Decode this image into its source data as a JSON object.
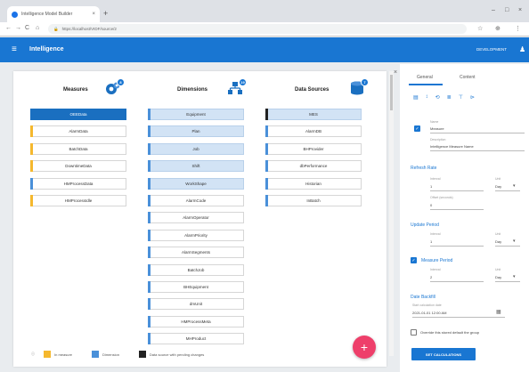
{
  "browser": {
    "tab_title": "Intelligence Model Builder",
    "tab_close": "×",
    "new_tab": "+",
    "win_min": "–",
    "win_max": "□",
    "win_close": "×",
    "nav_back": "←",
    "nav_forward": "→",
    "nav_reload": "C",
    "nav_home": "⌂",
    "url": "https://localhost/VIDF/source/2",
    "secure_icon": "🔒",
    "star_icon": "☆",
    "ext_icon": "⊕",
    "menu_icon": "⋮"
  },
  "appbar": {
    "menu_icon": "≡",
    "title": "Intelligence",
    "user": "DEVELOPMENT",
    "user_icon": "♟"
  },
  "columns": [
    {
      "title": "Measures",
      "badge": "8",
      "icon": "measures-gear-icon",
      "items": [
        {
          "label": "OEEData",
          "state": "sel-dark",
          "bar": "#1a6fc0"
        },
        {
          "label": "AlarmData",
          "state": "",
          "bar": "#f5b82e"
        },
        {
          "label": "BatchData",
          "state": "",
          "bar": "#f5b82e"
        },
        {
          "label": "DowntimeData",
          "state": "",
          "bar": "#f5b82e"
        },
        {
          "label": "HMProcessData",
          "state": "",
          "bar": "#4a90d9"
        },
        {
          "label": "HMProcessIdle",
          "state": "",
          "bar": "#f5b82e"
        }
      ]
    },
    {
      "title": "Dimensions",
      "badge": "19",
      "icon": "dimensions-hierarchy-icon",
      "items": [
        {
          "label": "Equipment",
          "state": "sel-light",
          "bar": "#4a90d9"
        },
        {
          "label": "Plan",
          "state": "sel-light",
          "bar": "#4a90d9"
        },
        {
          "label": "Job",
          "state": "sel-light",
          "bar": "#4a90d9"
        },
        {
          "label": "Shift",
          "state": "sel-light",
          "bar": "#4a90d9"
        },
        {
          "label": "WorkShape",
          "state": "sel-light",
          "bar": "#4a90d9"
        },
        {
          "label": "AlarmCode",
          "state": "",
          "bar": "#4a90d9"
        },
        {
          "label": "AlarmOperator",
          "state": "",
          "bar": "#4a90d9"
        },
        {
          "label": "AlarmPriority",
          "state": "",
          "bar": "#4a90d9"
        },
        {
          "label": "AlarmSegments",
          "state": "",
          "bar": "#4a90d9"
        },
        {
          "label": "BatchJob",
          "state": "",
          "bar": "#4a90d9"
        },
        {
          "label": "BHEquipment",
          "state": "",
          "bar": "#4a90d9"
        },
        {
          "label": "dmUnit",
          "state": "",
          "bar": "#4a90d9"
        },
        {
          "label": "HMProcessMeta",
          "state": "",
          "bar": "#4a90d9"
        },
        {
          "label": "MHProduct",
          "state": "",
          "bar": "#4a90d9"
        }
      ]
    },
    {
      "title": "Data Sources",
      "badge": "7",
      "icon": "data-sources-database-icon",
      "items": [
        {
          "label": "MES",
          "state": "sel-light",
          "bar": "#222222"
        },
        {
          "label": "AlarmDB",
          "state": "",
          "bar": "#4a90d9"
        },
        {
          "label": "BHProvider",
          "state": "",
          "bar": "#4a90d9"
        },
        {
          "label": "dbPerformance",
          "state": "",
          "bar": "#4a90d9"
        },
        {
          "label": "Historian",
          "state": "",
          "bar": "#4a90d9"
        },
        {
          "label": "InBatch",
          "state": "",
          "bar": "#4a90d9"
        }
      ]
    }
  ],
  "legend": [
    {
      "label": "In measure",
      "color": "#f5b82e"
    },
    {
      "label": "Dimension",
      "color": "#4a90d9"
    },
    {
      "label": "Data source with pending changes",
      "color": "#222222"
    }
  ],
  "legend_info_icon": "ⓘ",
  "fab_label": "+",
  "side": {
    "close": "×",
    "tab_general": "General",
    "tab_content": "Content",
    "toolbar_icons": [
      "▤",
      "↕",
      "⟲",
      "≣",
      "⊤",
      "⊳"
    ],
    "name_label": "Name",
    "name_value": "Measure",
    "desc_label": "Description",
    "desc_value": "Intelligence Measure Name",
    "refresh_title": "Refresh Rate",
    "interval_label": "Interval",
    "interval_value": "1",
    "unit_label": "Unit",
    "unit_value": "Day",
    "offset_label": "Offset (seconds)",
    "offset_value": "0",
    "update_title": "Update Period",
    "update_interval_label": "Interval",
    "update_interval_value": "1",
    "update_unit_label": "Unit",
    "update_unit_value": "Day",
    "measure_period_title": "Measure Period",
    "mp_interval_label": "Interval",
    "mp_interval_value": "2",
    "mp_unit_label": "Unit",
    "mp_unit_value": "Day",
    "date_backfill_title": "Date Backfill",
    "backfill_label": "Start calculation date",
    "backfill_value": "2021-01-01 12:00 AM",
    "calendar_icon": "▦",
    "override_label": "Override this stored default the group",
    "calc_button": "SET CALCULATIONS",
    "dropdown_icon": "▾"
  }
}
